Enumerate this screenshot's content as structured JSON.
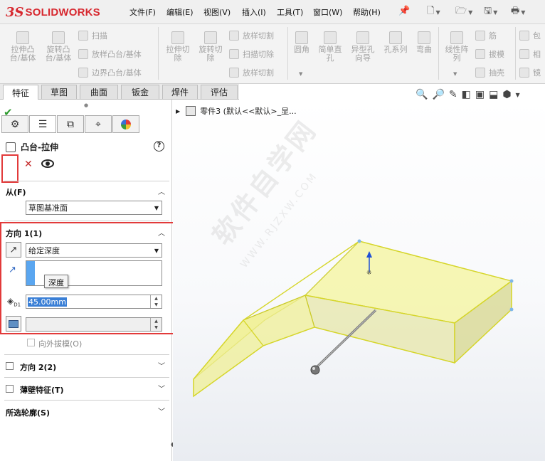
{
  "app": {
    "logo_ds": "3S",
    "logo_text": "SOLIDWORKS",
    "menu": [
      "文件(F)",
      "编辑(E)",
      "视图(V)",
      "插入(I)",
      "工具(T)",
      "窗口(W)",
      "帮助(H)"
    ]
  },
  "ribbon": {
    "large": [
      {
        "label": "拉伸凸\n台/基体"
      },
      {
        "label": "旋转凸\n台/基体"
      },
      {
        "label": "拉伸切\n除"
      },
      {
        "label": "旋转切\n除"
      },
      {
        "label": "圆角"
      },
      {
        "label": "简单直\n孔"
      },
      {
        "label": "异型孔\n向导"
      },
      {
        "label": "孔系列"
      },
      {
        "label": "弯曲"
      },
      {
        "label": "线性阵\n列"
      }
    ],
    "small": [
      {
        "label": "扫描"
      },
      {
        "label": "放样凸台/基体"
      },
      {
        "label": "边界凸台/基体"
      },
      {
        "label": "放样切割"
      },
      {
        "label": "扫描切除"
      },
      {
        "label": "放样切割"
      },
      {
        "label": "筋"
      },
      {
        "label": "拔模"
      },
      {
        "label": "抽壳"
      },
      {
        "label": "包"
      },
      {
        "label": "相"
      },
      {
        "label": "镜"
      }
    ]
  },
  "tabs": [
    "特征",
    "草图",
    "曲面",
    "钣金",
    "焊件",
    "评估"
  ],
  "active_tab": "特征",
  "tree": {
    "root": "零件3  (默认<<默认>_显..."
  },
  "property_manager": {
    "title": "凸台-拉伸",
    "help": "?",
    "from_section": {
      "title": "从(F)",
      "value": "草图基准面"
    },
    "direction1": {
      "title": "方向 1(1)",
      "end_condition": "给定深度",
      "tooltip": "深度",
      "depth": "45.00mm",
      "draft_outward_label": "向外拔模(O)"
    },
    "direction2": {
      "title": "方向 2(2)"
    },
    "thin_feature": {
      "title": "薄壁特征(T)"
    },
    "selected_contours": {
      "title": "所选轮廓(S)"
    }
  },
  "watermark": {
    "text": "软件自学网",
    "sub": "WWW.RJZXW.COM"
  },
  "colors": {
    "accent": "#d7282f",
    "highlight_box": "#e23a3a",
    "part_fill": "#f2f28a",
    "part_edge": "#d6d62a",
    "ok_green": "#2e9b2e",
    "depth_selection": "#3a7fd6"
  }
}
